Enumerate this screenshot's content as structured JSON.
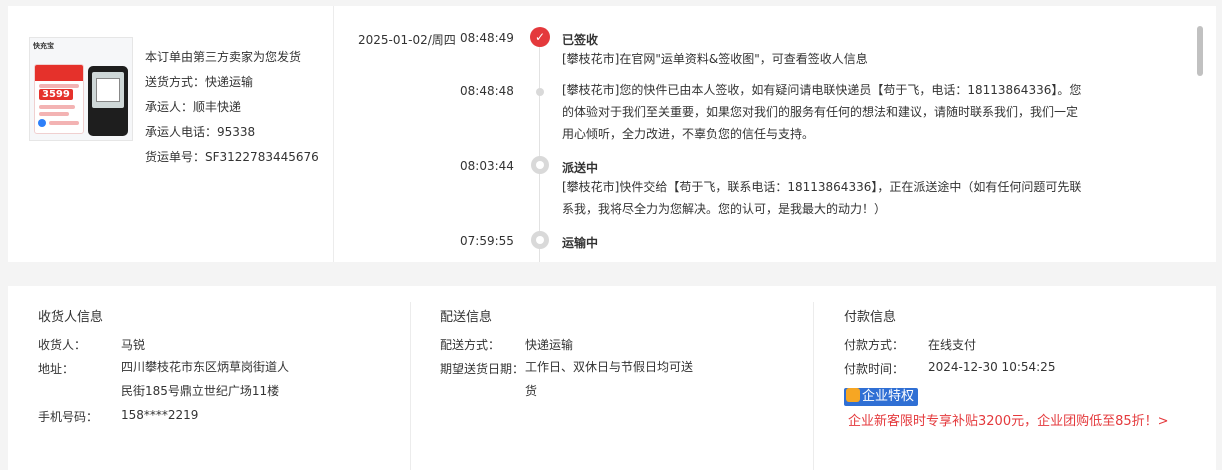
{
  "product": {
    "thumb_logo": "快充宝",
    "thumb_price": "3599",
    "info": [
      "本订单由第三方卖家为您发货",
      "送货方式：快递运输",
      "承运人：顺丰快递",
      "承运人电话：95338",
      "货运单号：SF3122783445676"
    ]
  },
  "timeline": {
    "date": "2025-01-02/周四",
    "entries": [
      {
        "time": "08:48:49",
        "status": "已签收",
        "text": "[攀枝花市]在官网\"运单资料&签收图\"，可查看签收人信息"
      },
      {
        "time": "08:48:48",
        "status": "",
        "text": "[攀枝花市]您的快件已由本人签收，如有疑问请电联快递员【苟于飞，电话：18113864336】。您的体验对于我们至关重要，如果您对我们的服务有任何的想法和建议，请随时联系我们，我们一定用心倾听，全力改进，不辜负您的信任与支持。"
      },
      {
        "time": "08:03:44",
        "status": "派送中",
        "text": "[攀枝花市]快件交给【苟于飞，联系电话：18113864336】，正在派送途中（如有任何问题可先联系我，我将尽全力为您解决。您的认可，是我最大的动力！）"
      },
      {
        "time": "07:59:55",
        "status": "运输中",
        "text": ""
      }
    ],
    "check_icon": "check-icon"
  },
  "receiver": {
    "title": "收货人信息",
    "name_label": "收货人：",
    "name": "马锐",
    "address_label": "地址：",
    "address": "四川攀枝花市东区炳草岗街道人民街185号鼎立世纪广场11楼",
    "phone_label": "手机号码：",
    "phone": "158****2219"
  },
  "delivery": {
    "title": "配送信息",
    "method_label": "配送方式：",
    "method": "快递运输",
    "date_label": "期望送货日期：",
    "date": "工作日、双休日与节假日均可送货"
  },
  "payment": {
    "title": "付款信息",
    "method_label": "付款方式：",
    "method": "在线支付",
    "time_label": "付款时间：",
    "time": "2024-12-30 10:54:25",
    "badge": "企业特权",
    "promo": "企业新客限时专享补贴3200元，企业团购低至85折！>"
  },
  "colors": {
    "accent": "#e4393c",
    "badge": "#2f6fd4"
  }
}
